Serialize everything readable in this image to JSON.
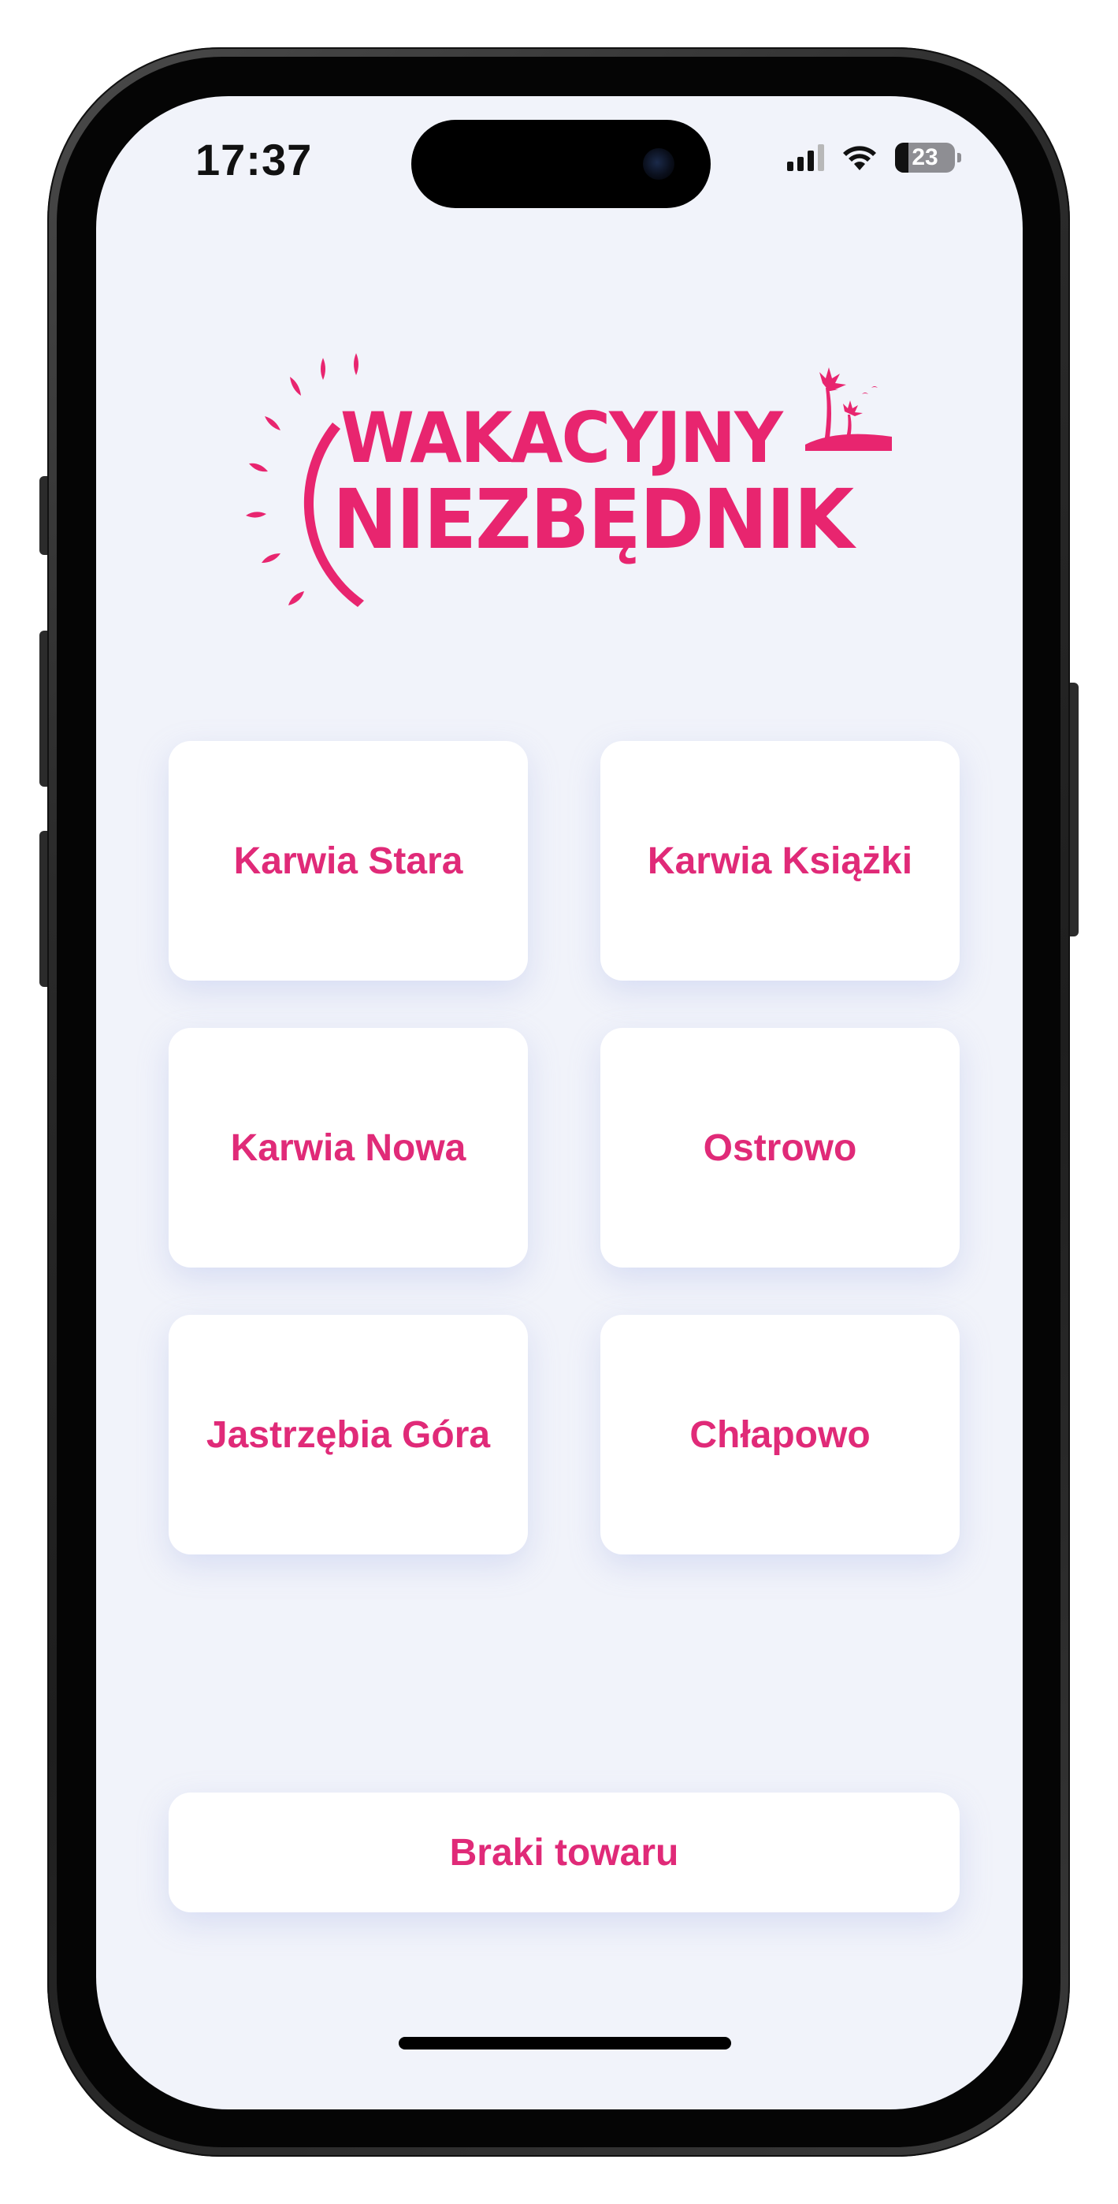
{
  "status_bar": {
    "time": "17:37",
    "battery_level": "23",
    "battery_fraction": 0.23,
    "signal_bars_active": 3,
    "signal_bars_total": 4
  },
  "app": {
    "logo_text_line_1": "WAKACYJNY",
    "logo_text_line_2": "NIEZBĘDNIK",
    "brand_color": "#e8256f"
  },
  "locations": [
    {
      "label": "Karwia Stara"
    },
    {
      "label": "Karwia Książki"
    },
    {
      "label": "Karwia Nowa"
    },
    {
      "label": "Ostrowo"
    },
    {
      "label": "Jastrzębia Góra"
    },
    {
      "label": "Chłapowo"
    }
  ],
  "actions": {
    "shortages_label": "Braki towaru"
  },
  "colors": {
    "screen_background": "#f1f3fa",
    "tile_background": "#ffffff",
    "accent": "#e02a78"
  },
  "icons": {
    "signal": "cellular-signal-icon",
    "wifi": "wifi-icon",
    "battery": "battery-icon",
    "logo_sun": "sun-icon",
    "logo_palm": "palm-tree-icon"
  }
}
